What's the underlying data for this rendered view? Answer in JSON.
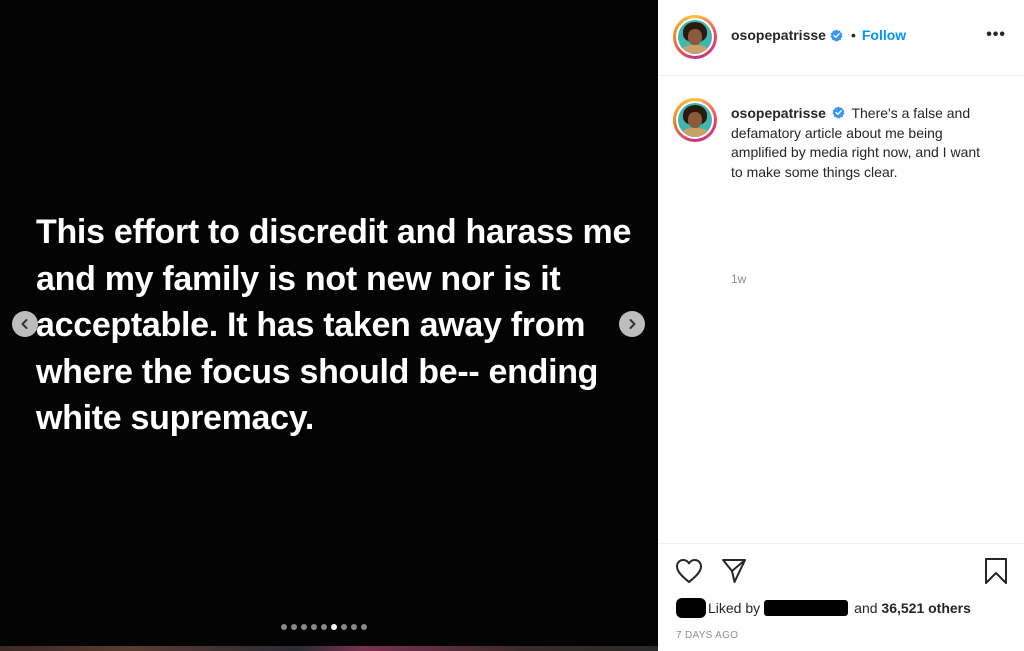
{
  "media": {
    "text": "This effort to discredit and harass me and my family is not new nor is it acceptable. It has taken away from where the focus should be-- ending white supremacy.",
    "dots_total": 9,
    "dots_active_index": 5
  },
  "header": {
    "username": "osopepatrisse",
    "separator": "•",
    "follow_label": "Follow",
    "more_label": "•••"
  },
  "caption": {
    "username": "osopepatrisse",
    "text": "There's a false and defamatory article about me being amplified by media right now, and I want to make some things clear.",
    "time": "1w"
  },
  "actions": {
    "liked_by_prefix": "Liked by",
    "liked_by_suffix": "and",
    "others_label": "36,521 others",
    "date": "7 DAYS AGO"
  },
  "colors": {
    "accent": "#0095f6",
    "verified": "#3897f0",
    "text": "#262626",
    "muted": "#8e8e8e"
  },
  "icons": [
    "chevron-left-icon",
    "chevron-right-icon",
    "verified-badge-icon",
    "more-icon",
    "heart-icon",
    "share-icon",
    "bookmark-icon"
  ]
}
